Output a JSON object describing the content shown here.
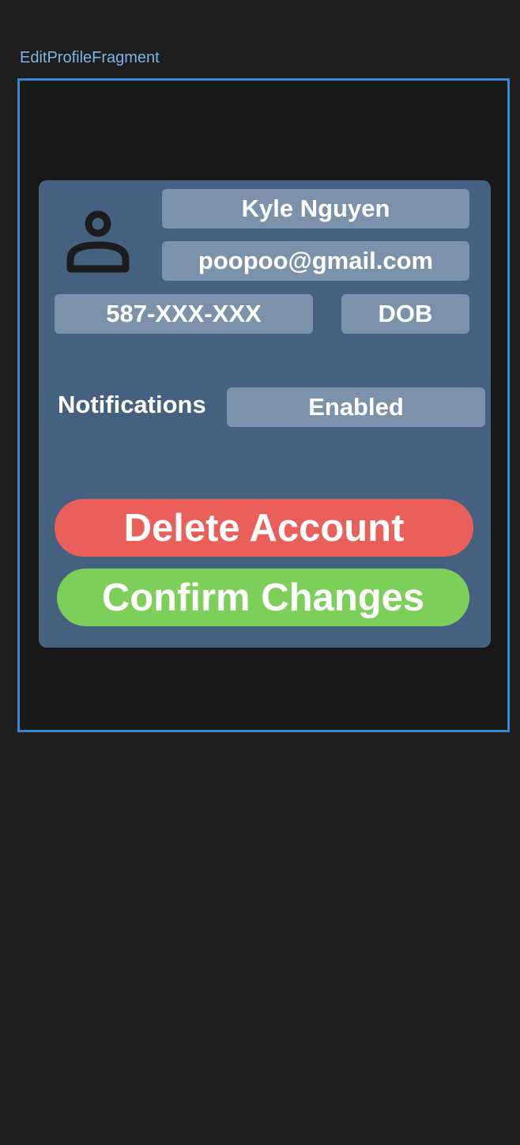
{
  "frame": {
    "label": "EditProfileFragment"
  },
  "profile": {
    "avatar_icon": "person-icon",
    "name": "Kyle Nguyen",
    "email": "poopoo@gmail.com",
    "phone": "587-XXX-XXX",
    "dob_label": "DOB"
  },
  "notifications": {
    "label": "Notifications",
    "value": "Enabled"
  },
  "actions": {
    "delete_label": "Delete Account",
    "confirm_label": "Confirm Changes"
  },
  "colors": {
    "background": "#1e1e1e",
    "frame_border": "#3a86d4",
    "card": "#46617f",
    "field": "#7c92ab",
    "delete": "#e95f5a",
    "confirm": "#7ccf58"
  }
}
